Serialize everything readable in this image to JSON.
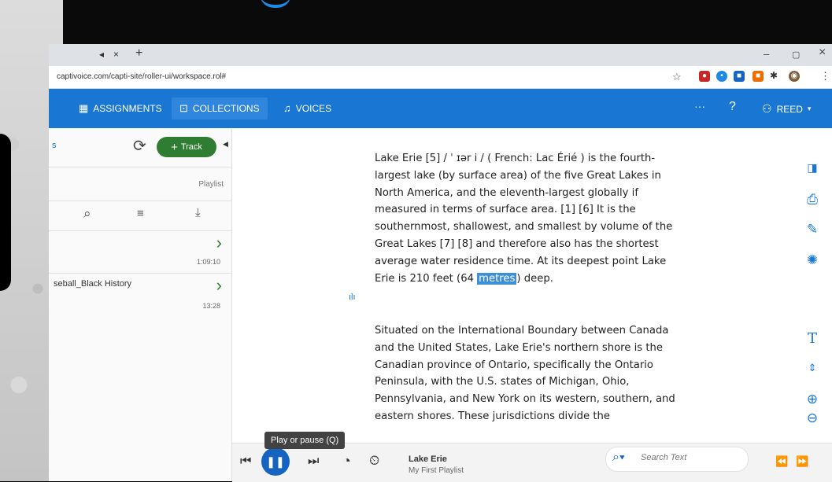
{
  "browser": {
    "tab_mute": "◂",
    "tab_close": "×",
    "new_tab": "+",
    "minimize": "–",
    "restore": "▢",
    "close": "×",
    "url": "captivoice.com/capti-site/roller-ui/workspace.rol#"
  },
  "appbar": {
    "assignments": "ASSIGNMENTS",
    "collections": "COLLECTIONS",
    "voices": "VOICES",
    "more": "···",
    "help": "?",
    "user": "REED"
  },
  "sidebar": {
    "partial_label": "s",
    "track_label": "Track",
    "playlist_label": "Playlist",
    "items": [
      {
        "title": "",
        "duration": "1:09:10"
      },
      {
        "title": "seball_Black History",
        "duration": "13:28"
      }
    ]
  },
  "content": {
    "paragraph1_a": "Lake Erie [5] / ˈ ɪər i / ( French: Lac Érié ) is the fourth-largest lake (by surface area) of the five Great Lakes in North America, and the eleventh-largest globally if measured in terms of surface area. [1] [6] It is the southernmost, shallowest, and smallest by volume of the Great Lakes [7] [8] and therefore also has the shortest average water residence time. At its deepest point Lake Erie is 210 feet (64 ",
    "paragraph1_highlight": "metres",
    "paragraph1_b": ") deep.",
    "paragraph2": "Situated on the International Boundary between Canada and the United States, Lake Erie's northern shore is the Canadian province of Ontario, specifically the Ontario Peninsula, with the U.S. states of Michigan, Ohio, Pennsylvania, and New York on its western, southern, and eastern shores. These jurisdictions divide the"
  },
  "player": {
    "tooltip": "Play or pause (Q)",
    "track_title": "Lake Erie",
    "playlist_name": "My First Playlist",
    "search_placeholder": "Search Text"
  },
  "colors": {
    "appbar": "#1976d2",
    "track_button": "#2e7d32",
    "highlight": "#3d8fd6"
  }
}
